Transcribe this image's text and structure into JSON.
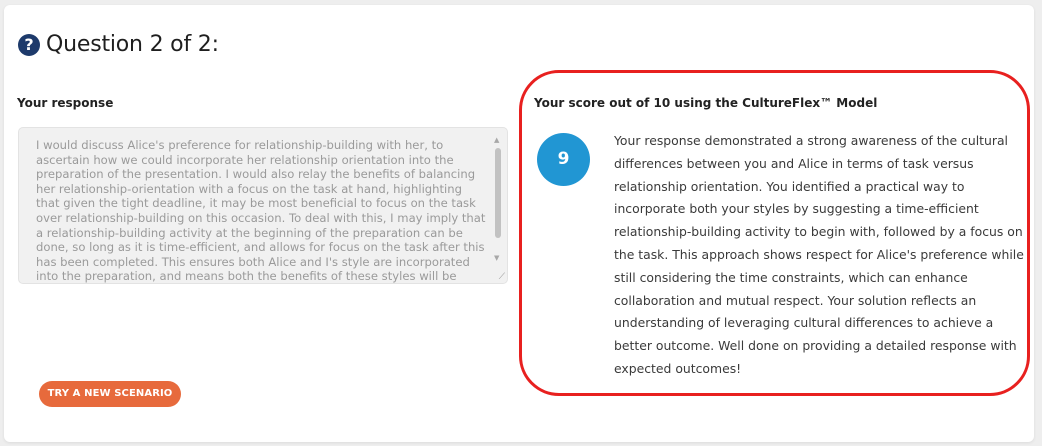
{
  "question": {
    "icon": "help-circle-icon",
    "title": "Question 2 of 2:"
  },
  "response": {
    "label": "Your response",
    "text": "I would discuss Alice's preference for relationship-building with her, to ascertain how we could incorporate her relationship orientation into the preparation of the presentation. I would also relay the benefits of balancing her relationship-orientation with a focus on the task at hand, highlighting that given the tight deadline, it may be most beneficial to focus on the task over relationship-building on this occasion. To deal with this, I may imply that a relationship-building activity at the beginning of the preparation can be done, so long as it is time-efficient, and allows for focus on the task after this has been completed. This ensures both Alice and I's style are incorporated into the preparation, and means both the benefits of these styles will be witnessed"
  },
  "score": {
    "label": "Your score out of 10 using the CultureFlex™ Model",
    "value": "9",
    "feedback": "Your response demonstrated a strong awareness of the cultural differences between you and Alice in terms of task versus relationship orientation. You identified a practical way to incorporate both your styles by suggesting a time-efficient relationship-building activity to begin with, followed by a focus on the task. This approach shows respect for Alice's preference while still considering the time constraints, which can enhance collaboration and mutual respect. Your solution reflects an understanding of leveraging cultural differences to achieve a better outcome. Well done on providing a detailed response with expected outcomes!"
  },
  "actions": {
    "try_new": "TRY A NEW SCENARIO"
  },
  "colors": {
    "accent_orange": "#e76a3c",
    "score_blue": "#2196d3",
    "highlight_red": "#e8201f",
    "icon_navy": "#1d3a6b"
  }
}
